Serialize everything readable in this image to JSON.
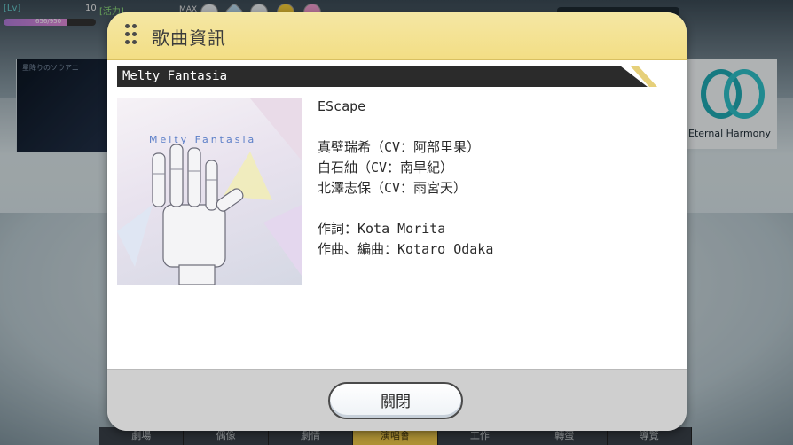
{
  "hud": {
    "level_label": "[Lv]",
    "level_value": "10",
    "stamina_label": "[活力]",
    "stamina_text": "656/950",
    "stamina_fraction": 0.69,
    "max_label": "MAX"
  },
  "background": {
    "left_banner_text": "星降りのソウアニ",
    "right_banner_text": "Eternal Harmony",
    "bottom_tabs": [
      "劇場",
      "偶像",
      "劇情",
      "演唱會",
      "工作",
      "轉蛋",
      "導覽"
    ],
    "active_tab_index": 3
  },
  "dialog": {
    "title": "歌曲資訊",
    "song_title": "Melty Fantasia",
    "cover_text": "Melty Fantasia",
    "unit": "EScape",
    "singers": [
      "真壁瑞希（CV：阿部里果）",
      "白石紬（CV：南早紀）",
      "北澤志保（CV：雨宮天）"
    ],
    "lyricist": "作詞：Kota Morita",
    "composer": "作曲、編曲：Kotaro Odaka",
    "close_label": "關閉"
  },
  "colors": {
    "header": "#f3de85",
    "song_bar": "#2b2b2b",
    "accent_gold": "#e6d07a",
    "footer": "#cfcfcf"
  }
}
